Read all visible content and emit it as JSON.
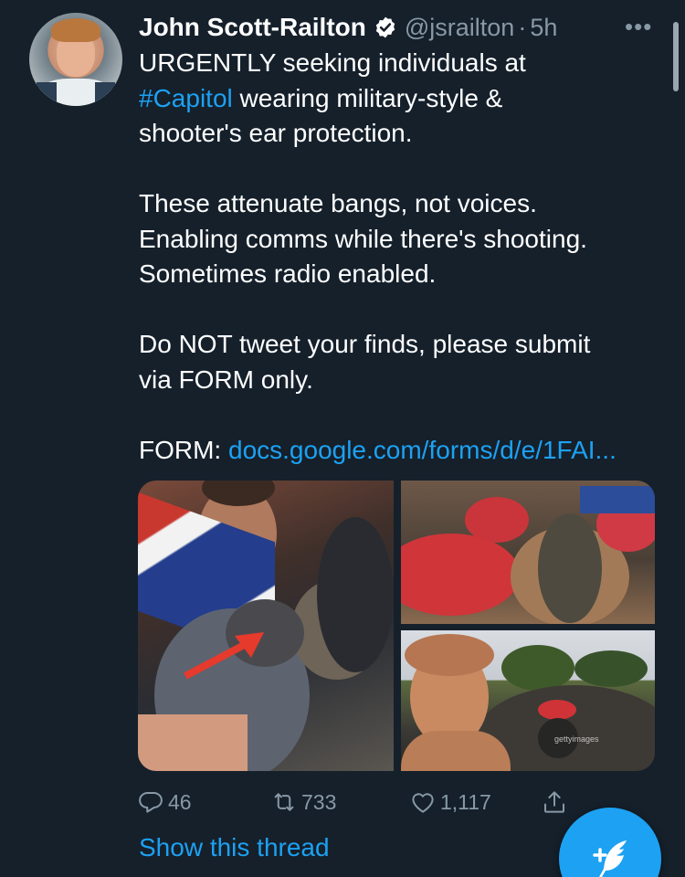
{
  "tweet": {
    "author_name": "John Scott-Railton",
    "handle": "@jsrailton",
    "separator": "·",
    "time": "5h",
    "more_label": "•••",
    "lines": [
      {
        "parts": [
          {
            "text": "URGENTLY seeking individuals at"
          }
        ]
      },
      {
        "parts": [
          {
            "text": "#Capitol",
            "link": true
          },
          {
            "text": " wearing military-style &"
          }
        ]
      },
      {
        "parts": [
          {
            "text": "shooter's ear protection."
          }
        ]
      },
      {
        "parts": [
          {
            "text": ""
          }
        ]
      },
      {
        "parts": [
          {
            "text": "These attenuate bangs, not voices."
          }
        ]
      },
      {
        "parts": [
          {
            "text": "Enabling comms while there's shooting."
          }
        ]
      },
      {
        "parts": [
          {
            "text": "Sometimes radio enabled."
          }
        ]
      },
      {
        "parts": [
          {
            "text": ""
          }
        ]
      },
      {
        "parts": [
          {
            "text": "Do NOT tweet your finds, please submit"
          }
        ]
      },
      {
        "parts": [
          {
            "text": "via FORM only."
          }
        ]
      },
      {
        "parts": [
          {
            "text": ""
          }
        ]
      },
      {
        "parts": [
          {
            "text": "FORM: "
          },
          {
            "text": "docs.google.com/forms/d/e/1FAI...",
            "link": true
          }
        ]
      }
    ],
    "media_watermark": "gettyimages",
    "stats": {
      "replies": "46",
      "retweets": "733",
      "likes": "1,117"
    },
    "show_thread_label": "Show this thread"
  },
  "colors": {
    "background": "#15202b",
    "accent": "#1da1f2",
    "secondary_text": "#8899a6",
    "annotation_arrow": "#e53a2c"
  },
  "icons": {
    "verified": "verified-badge-icon",
    "reply": "reply-icon",
    "retweet": "retweet-icon",
    "like": "heart-icon",
    "share": "share-icon",
    "compose": "compose-tweet-icon",
    "more": "more-options-icon"
  }
}
